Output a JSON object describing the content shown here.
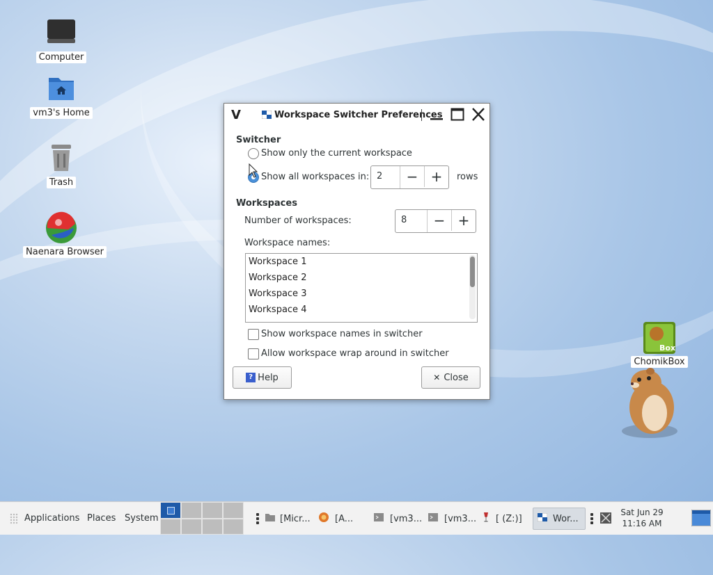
{
  "desktop": {
    "icons": [
      {
        "label": "Computer",
        "icon": "monitor-icon"
      },
      {
        "label": "vm3's Home",
        "icon": "home-folder-icon"
      },
      {
        "label": "Trash",
        "icon": "trash-icon"
      },
      {
        "label": "Naenara Browser",
        "icon": "globe-browser-icon"
      },
      {
        "label": "ChomikBox",
        "icon": "chomikbox-icon"
      }
    ]
  },
  "dialog": {
    "title": "Workspace Switcher Preferences",
    "logo": "V",
    "switcher": {
      "heading": "Switcher",
      "option_current": "Show only the current workspace",
      "option_all": "Show all workspaces in:",
      "rows_value": "2",
      "rows_label": "rows",
      "selected": "all"
    },
    "workspaces": {
      "heading": "Workspaces",
      "number_label": "Number of workspaces:",
      "number_value": "8",
      "names_label": "Workspace names:",
      "names": [
        "Workspace 1",
        "Workspace 2",
        "Workspace 3",
        "Workspace 4"
      ]
    },
    "checks": {
      "show_names": "Show workspace names in switcher",
      "wrap_around": "Allow workspace wrap around in switcher"
    },
    "buttons": {
      "help_icon": "?",
      "help": "Help",
      "close_icon": "✕",
      "close": "Close"
    }
  },
  "taskbar": {
    "menu": [
      "Applications",
      "Places",
      "System"
    ],
    "tasks": [
      {
        "label": "[Micr...",
        "icon": "folder-icon"
      },
      {
        "label": "[A...",
        "icon": "browser-icon"
      },
      {
        "label": "[vm3...",
        "icon": "terminal-icon"
      },
      {
        "label": "[vm3...",
        "icon": "terminal-icon"
      },
      {
        "label": "[ (Z:)]",
        "icon": "wine-icon"
      },
      {
        "label": "Wor...",
        "icon": "workspace-icon"
      }
    ],
    "clock_date": "Sat Jun 29",
    "clock_time": "11:16 AM"
  }
}
